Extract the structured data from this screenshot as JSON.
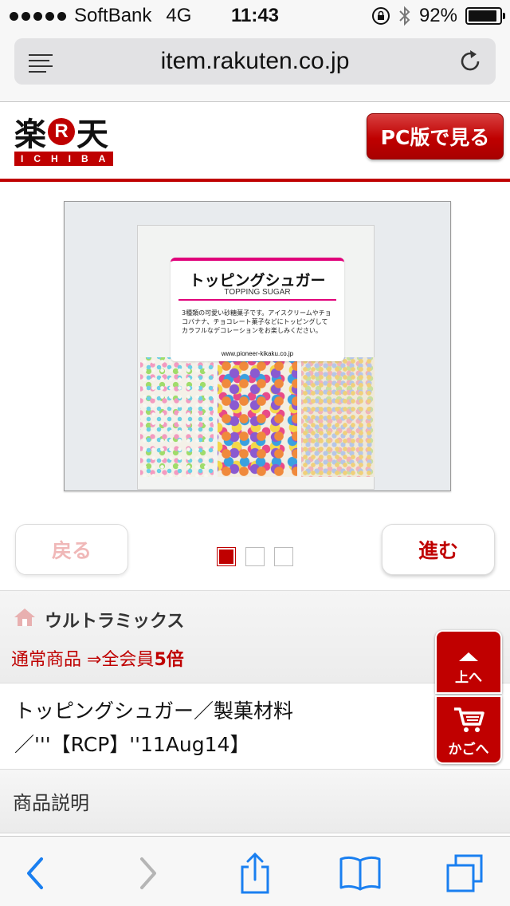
{
  "status_bar": {
    "carrier": "SoftBank",
    "network": "4G",
    "time": "11:43",
    "battery": "92%",
    "battery_level": 0.92
  },
  "browser": {
    "url": "item.rakuten.co.jp"
  },
  "header": {
    "logo_kanji_left": "楽",
    "logo_r": "R",
    "logo_kanji_right": "天",
    "logo_sub": "ICHIBA",
    "pc_button": "PC版で見る"
  },
  "product_image": {
    "package_title_jp": "トッピングシュガー",
    "package_title_en": "TOPPING SUGAR",
    "package_desc": "3種類の可愛い砂糖菓子です。アイスクリームやチョコバナナ、チョコレート菓子などにトッピングしてカラフルなデコレーションをお楽しみください。",
    "package_url": "www.pioneer-kikaku.co.jp"
  },
  "pager": {
    "back_label": "戻る",
    "next_label": "進む",
    "total": 3,
    "current": 1
  },
  "shop": {
    "name": "ウルトラミックス",
    "point_prefix": "通常商品 ⇒全会員",
    "point_value": "5倍"
  },
  "item": {
    "title": "トッピングシュガー／製菓材料／'''【RCP】''11Aug14】"
  },
  "description_header": "商品説明",
  "floating": {
    "top_label": "上へ",
    "cart_label": "かごへ"
  },
  "colors": {
    "brand_red": "#bf0000",
    "ios_blue": "#1a7ff0"
  }
}
